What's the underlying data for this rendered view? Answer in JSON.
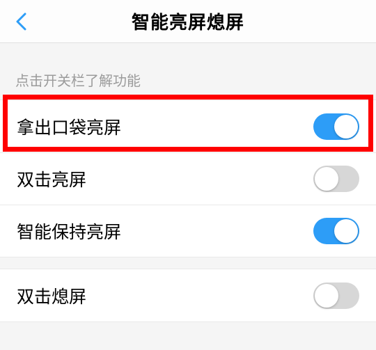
{
  "header": {
    "title": "智能亮屏熄屏"
  },
  "section": {
    "hint": "点击开关栏了解功能"
  },
  "rows": {
    "pocket": {
      "label": "拿出口袋亮屏",
      "on": true
    },
    "doubletap_on": {
      "label": "双击亮屏",
      "on": false
    },
    "keep_on": {
      "label": "智能保持亮屏",
      "on": true
    },
    "doubletap_off": {
      "label": "双击熄屏",
      "on": false
    }
  },
  "colors": {
    "accent": "#2d9df7",
    "highlight": "#ff0000"
  }
}
